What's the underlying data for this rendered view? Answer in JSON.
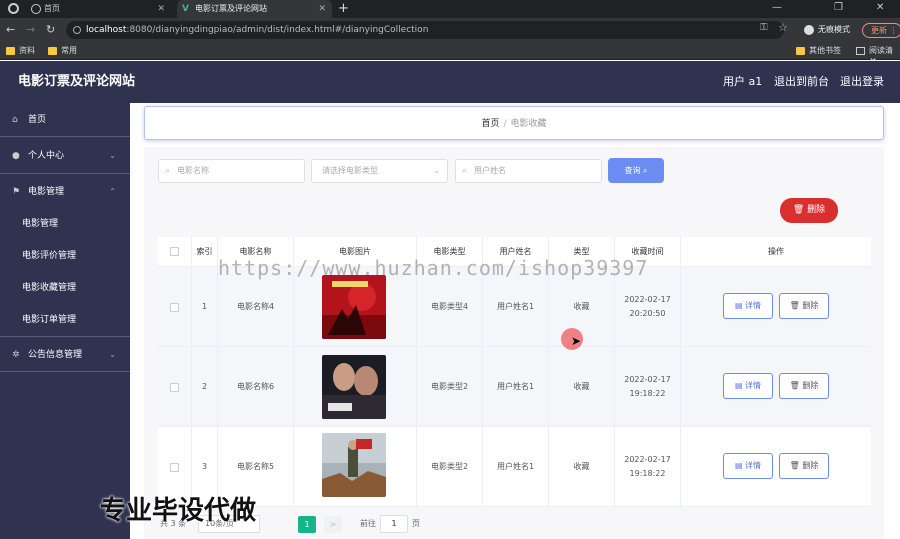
{
  "browser": {
    "tabs": [
      {
        "label": "首页"
      },
      {
        "label": "电影订票及评论网站"
      }
    ],
    "url_host": "localhost",
    "url_rest": ":8080/dianyingdingpiao/admin/dist/index.html#/dianyingCollection",
    "profile_label": "无痕模式",
    "update_label": "更新",
    "bookmarks": [
      "资料",
      "常用",
      "其他书签",
      "阅读清单"
    ]
  },
  "header": {
    "brand": "电影订票及评论网站",
    "user": "用户 a1",
    "back_front": "退出到前台",
    "logout": "退出登录"
  },
  "sidebar": {
    "items": [
      {
        "label": "首页",
        "icon": "home-icon"
      },
      {
        "label": "个人中心",
        "icon": "user-icon"
      },
      {
        "label": "电影管理",
        "icon": "flag-icon"
      }
    ],
    "sub_items": [
      "电影管理",
      "电影评价管理",
      "电影收藏管理",
      "电影订单管理"
    ],
    "notice": {
      "label": "公告信息管理",
      "icon": "gear-icon"
    }
  },
  "breadcrumb": {
    "home": "首页",
    "sep": "/",
    "current": "电影收藏"
  },
  "filters": {
    "name_placeholder": "电影名称",
    "type_placeholder": "请选择电影类型",
    "user_placeholder": "用户姓名",
    "query_label": "查询"
  },
  "batch_delete_label": "删除",
  "table": {
    "headers": [
      "索引",
      "电影名称",
      "电影图片",
      "电影类型",
      "用户姓名",
      "类型",
      "收藏时间",
      "操作"
    ],
    "rows": [
      {
        "index": "1",
        "name": "电影名称4",
        "type": "电影类型4",
        "user": "用户姓名1",
        "kind": "收藏",
        "date": "2022-02-17",
        "time": "20:20:50"
      },
      {
        "index": "2",
        "name": "电影名称6",
        "type": "电影类型2",
        "user": "用户姓名1",
        "kind": "收藏",
        "date": "2022-02-17",
        "time": "19:18:22"
      },
      {
        "index": "3",
        "name": "电影名称5",
        "type": "电影类型2",
        "user": "用户姓名1",
        "kind": "收藏",
        "date": "2022-02-17",
        "time": "19:18:22"
      }
    ],
    "detail_label": "详情",
    "delete_label": "删除"
  },
  "pagination": {
    "total": "共 3 条",
    "page_size": "10条/页",
    "current": "1",
    "next": ">",
    "goto": "前往",
    "goto_value": "1",
    "unit": "页"
  },
  "watermarks": {
    "url": "https://www.huzhan.com/ishop39397",
    "cn": "专业毕设代做"
  }
}
